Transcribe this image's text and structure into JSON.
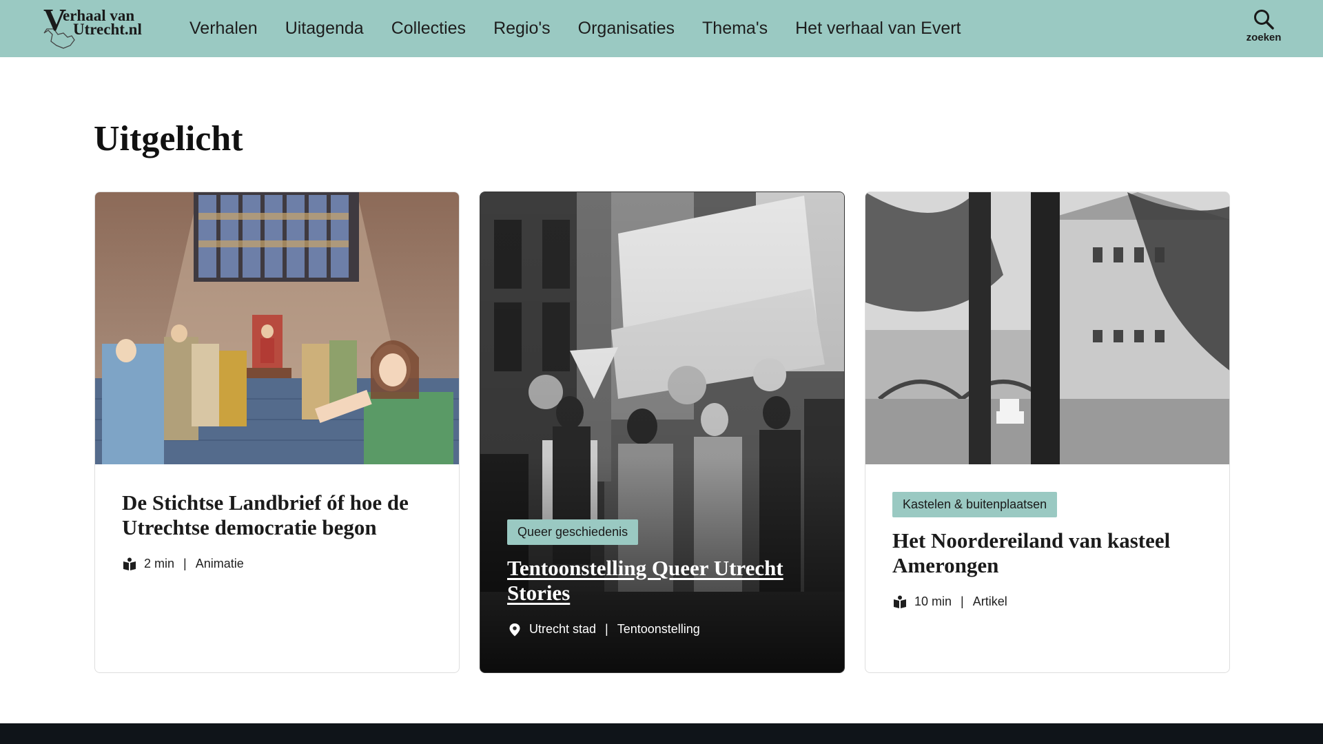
{
  "header": {
    "logo_line1": "erhaal van",
    "logo_line2": "Utrecht.nl",
    "logo_v": "V",
    "nav": [
      "Verhalen",
      "Uitagenda",
      "Collecties",
      "Regio's",
      "Organisaties",
      "Thema's",
      "Het verhaal van Evert"
    ],
    "search_label": "zoeken"
  },
  "main": {
    "section_title": "Uitgelicht",
    "cards": [
      {
        "tag": "",
        "title": "De Stichtse Landbrief óf hoe de Utrechtse democratie begon",
        "meta_primary": "2 min",
        "meta_secondary": "Animatie",
        "meta_icon": "book-icon"
      },
      {
        "tag": "Queer geschiedenis",
        "title": "Tentoonstelling Queer Utrecht Stories",
        "meta_primary": "Utrecht stad",
        "meta_secondary": "Tentoonstelling",
        "meta_icon": "location-pin-icon"
      },
      {
        "tag": "Kastelen & buitenplaatsen",
        "title": "Het Noordereiland van kasteel Amerongen",
        "meta_primary": "10 min",
        "meta_secondary": "Artikel",
        "meta_icon": "book-icon"
      }
    ]
  },
  "colors": {
    "header_bg": "#9ac9c2",
    "tag_bg": "#9ac9c2",
    "footer_bg": "#0f1419"
  }
}
